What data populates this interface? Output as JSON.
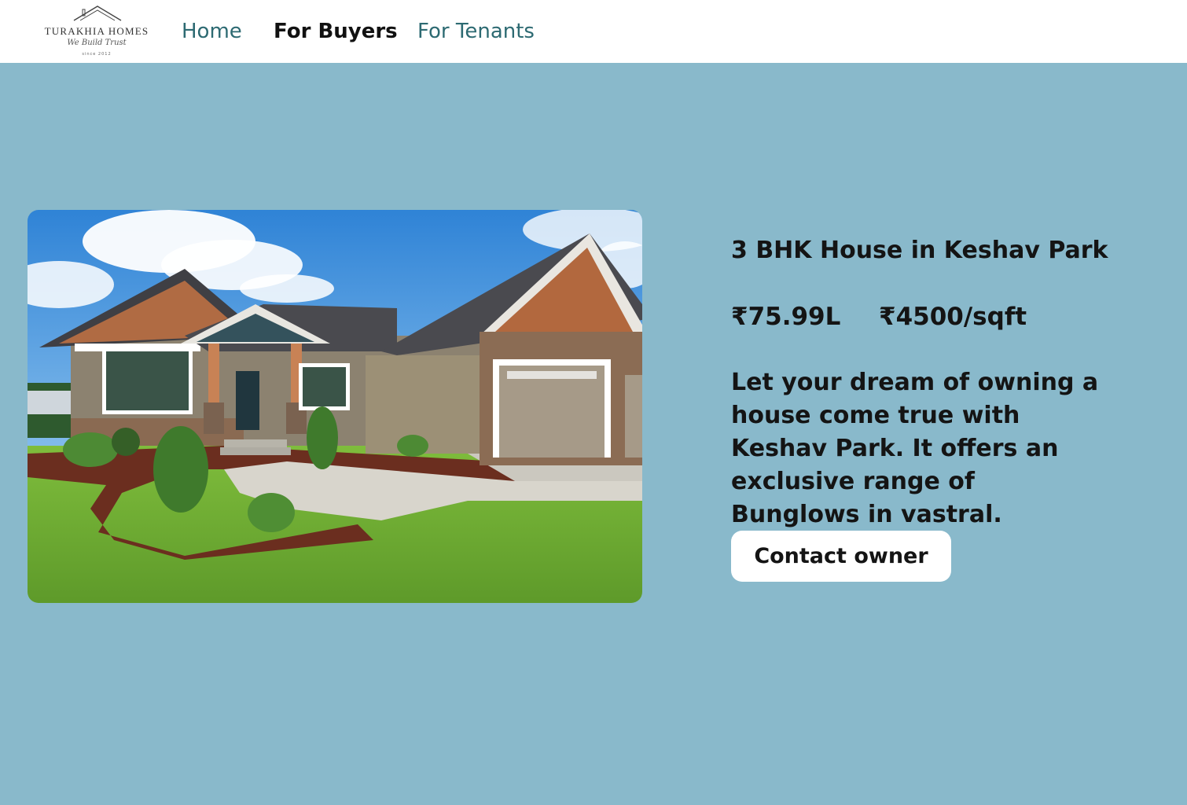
{
  "brand": {
    "name": "TURAKHIA HOMES",
    "tagline": "We Build Trust",
    "since": "since 2012"
  },
  "nav": {
    "items": [
      {
        "label": "Home",
        "active": false
      },
      {
        "label": "For Buyers",
        "active": true
      },
      {
        "label": "For Tenants",
        "active": false
      }
    ]
  },
  "listing": {
    "title": "3 BHK House in Keshav Park",
    "price": "₹75.99L",
    "price_per_sqft": "₹4500/sqft",
    "description": "Let your dream of owning a house come true with Keshav Park. It offers an exclusive range of Bunglows in vastral.",
    "cta_label": "Contact owner"
  },
  "colors": {
    "background": "#89b9cb",
    "navbar": "#ffffff",
    "nav_link": "#2d6a72",
    "nav_active": "#111111",
    "button": "#ffffff"
  }
}
